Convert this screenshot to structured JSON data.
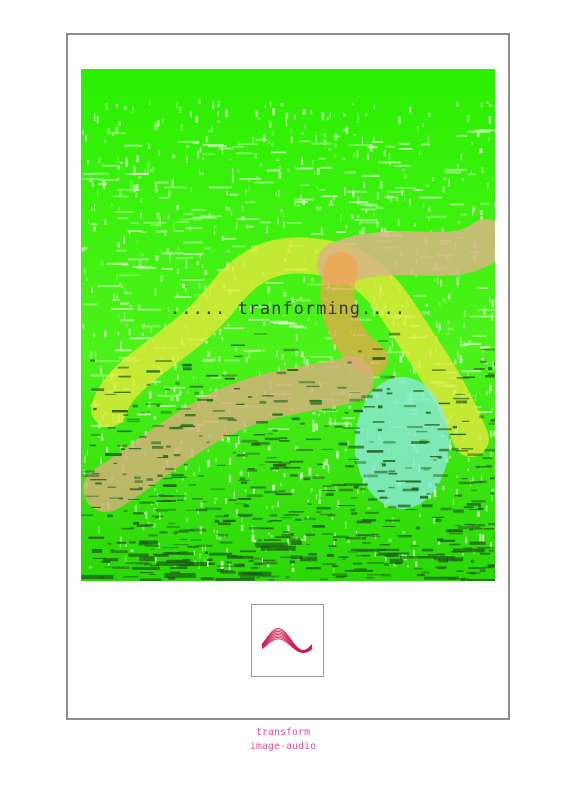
{
  "artwork": {
    "overlay_text": "..... tranforming....",
    "colors": {
      "background_green": "#22ee00",
      "texture_light": "#e6f7d8",
      "texture_dark": "#1e6b1a",
      "yellow_stroke": "#e6e83a",
      "tan_stroke": "#d8b07a",
      "orange_stroke": "#f0a050",
      "cyan_ellipse": "#8fe6e0"
    }
  },
  "thumbnail": {
    "icon": "waveform-icon",
    "color": "#d0104a"
  },
  "caption": {
    "line1": "transform",
    "line2": "image-audio",
    "color": "#e0529c"
  },
  "frame": {
    "border_color": "#8e8e8e"
  }
}
